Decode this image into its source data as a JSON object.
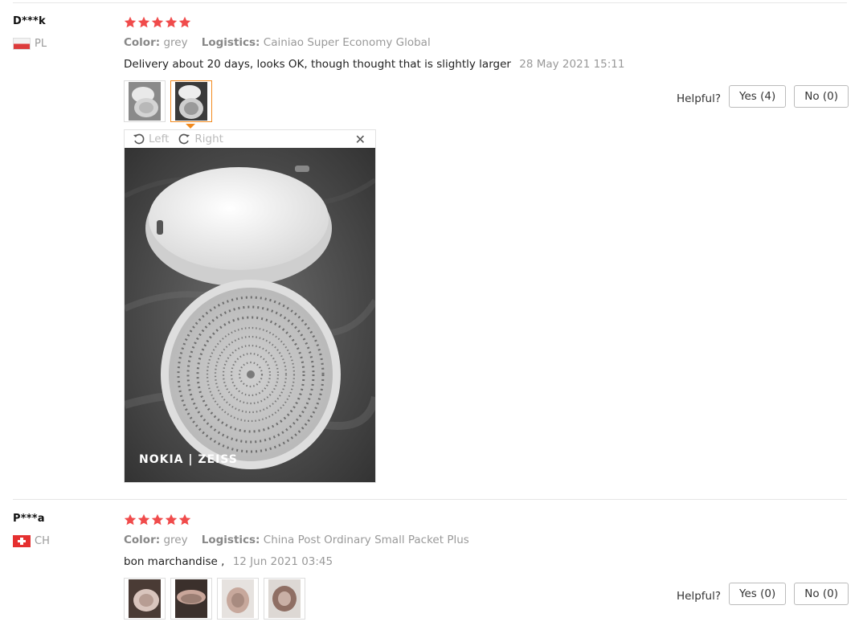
{
  "reviews": [
    {
      "user": "D***k",
      "country": "PL",
      "rating": 5,
      "color_label": "Color:",
      "color_value": "grey",
      "logistics_label": "Logistics:",
      "logistics_value": "Cainiao Super Economy Global",
      "text": "Delivery about 20 days, looks OK, though thought that is slightly larger",
      "date": "28 May 2021 15:11",
      "helpful_label": "Helpful?",
      "yes_label": "Yes (4)",
      "no_label": "No (0)",
      "photos": 2
    },
    {
      "user": "P***a",
      "country": "CH",
      "rating": 5,
      "color_label": "Color:",
      "color_value": "grey",
      "logistics_label": "Logistics:",
      "logistics_value": "China Post Ordinary Small Packet Plus",
      "text": "bon marchandise ,",
      "date": "12 Jun 2021 03:45",
      "helpful_label": "Helpful?",
      "yes_label": "Yes (0)",
      "no_label": "No (0)",
      "photos": 4
    }
  ],
  "viewer": {
    "left_label": "Left",
    "right_label": "Right",
    "close_icon": "close-icon",
    "watermark": "NOKIA | ZEISS"
  },
  "colors": {
    "star": "#f04b4b",
    "accent": "#f28a1e"
  }
}
